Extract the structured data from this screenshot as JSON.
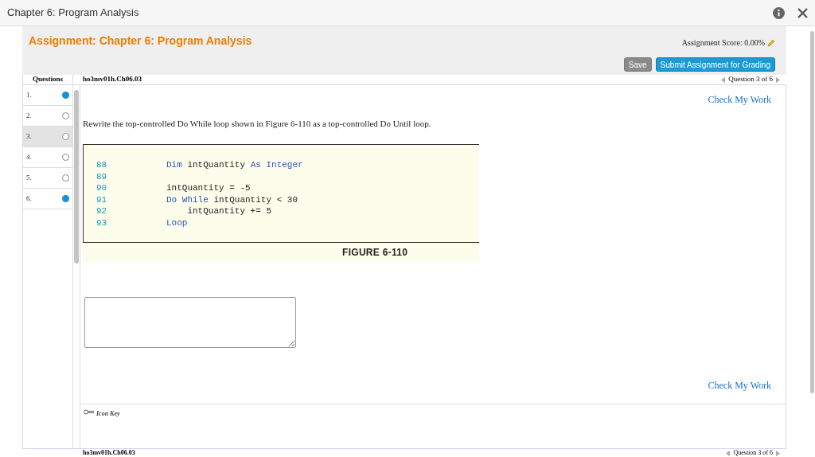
{
  "window": {
    "title": "Chapter 6: Program Analysis"
  },
  "assignment": {
    "title": "Assignment: Chapter 6: Program Analysis",
    "score": "Assignment Score: 0.00%",
    "buttons": [
      {
        "label": "Save",
        "kind": "secondary"
      },
      {
        "label": "Submit Assignment for Grading",
        "kind": "primary"
      }
    ]
  },
  "questions_header": "Questions",
  "questions": [
    {
      "label": "1.",
      "answered": true,
      "selected": false
    },
    {
      "label": "2.",
      "answered": false,
      "selected": false
    },
    {
      "label": "3.",
      "answered": false,
      "selected": true
    },
    {
      "label": "4.",
      "answered": false,
      "selected": false
    },
    {
      "label": "5.",
      "answered": false,
      "selected": false
    },
    {
      "label": "6.",
      "answered": true,
      "selected": false
    }
  ],
  "question": {
    "id": "ho3mv01h.Ch06.03",
    "nav": "Question 3 of 6",
    "check_top": "Check My Work",
    "prompt": "Rewrite the top-controlled Do While loop shown in Figure 6-110 as a top-controlled Do Until loop.",
    "code_lines": [
      {
        "number": "88",
        "tokens": [
          {
            "text": "Dim",
            "kind": "keyword"
          },
          {
            "text": " intQuantity ",
            "kind": "plain"
          },
          {
            "text": "As Integer",
            "kind": "keyword"
          }
        ]
      },
      {
        "number": "89"
      },
      {
        "number": "90",
        "tokens": [
          {
            "text": "intQuantity = -5",
            "kind": "plain"
          }
        ]
      },
      {
        "number": "91",
        "tokens": [
          {
            "text": "Do While",
            "kind": "keyword"
          },
          {
            "text": " intQuantity < 30",
            "kind": "plain"
          }
        ]
      },
      {
        "number": "92",
        "tokens": [
          {
            "text": "    intQuantity += 5",
            "kind": "plain"
          }
        ]
      },
      {
        "number": "93",
        "tokens": [
          {
            "text": "Loop",
            "kind": "keyword"
          }
        ]
      }
    ],
    "figure_caption": "FIGURE 6-110",
    "check_bottom": "Check My Work",
    "icon_key": "Icon Key"
  },
  "footer": {
    "id": "ho3mv01h.Ch06.03",
    "nav": "Question 3 of 6"
  }
}
